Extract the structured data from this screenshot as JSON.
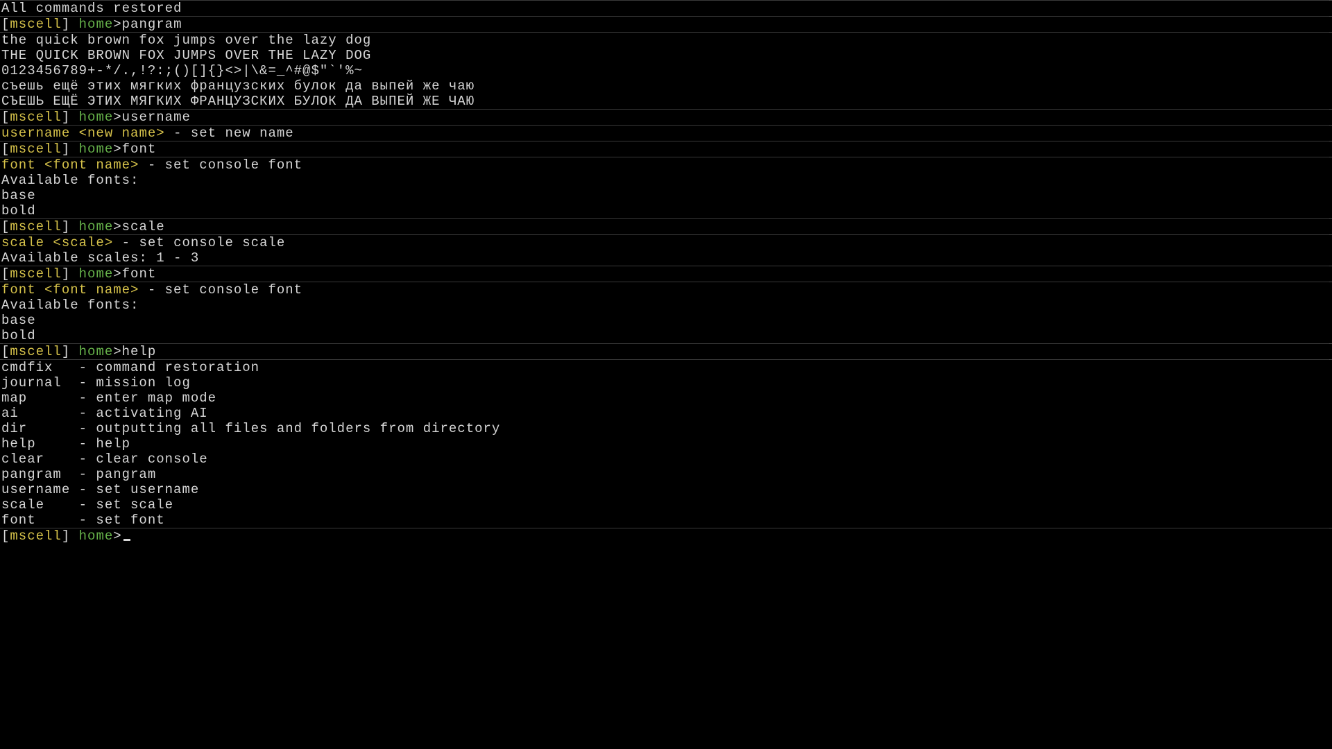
{
  "prompt": {
    "lb": "[",
    "user": "mscell",
    "rb": "]",
    "path": "home",
    "sep": ">"
  },
  "intro": {
    "restored": "All commands restored"
  },
  "history": [
    {
      "cmd": "pangram"
    },
    {
      "cmd": "username"
    },
    {
      "cmd": "font"
    },
    {
      "cmd": "scale"
    },
    {
      "cmd": "font"
    },
    {
      "cmd": "help"
    }
  ],
  "pangram_output": [
    "the quick brown fox jumps over the lazy dog",
    "THE QUICK BROWN FOX JUMPS OVER THE LAZY DOG",
    "0123456789+-*/.,!?:;()[]{}<>|\\&=_^#@$\"`'%~",
    "съешь ещё этих мягких французских булок да выпей же чаю",
    "СЪЕШЬ ЕЩЁ ЭТИХ МЯГКИХ ФРАНЦУЗСКИХ БУЛОК ДА ВЫПЕЙ ЖЕ ЧАЮ"
  ],
  "username_usage": {
    "cmd": "username ",
    "arg": "<new name>",
    "desc": " - set new name"
  },
  "font_usage": {
    "cmd": "font ",
    "arg": "<font name>",
    "desc": " - set console font",
    "avail_label": "Available fonts:",
    "fonts": [
      "base",
      "bold"
    ]
  },
  "scale_usage": {
    "cmd": "scale ",
    "arg": "<scale>",
    "desc": " - set console scale",
    "avail": "Available scales: 1 - 3"
  },
  "help": [
    {
      "name": "cmdfix",
      "desc": "command restoration"
    },
    {
      "name": "journal",
      "desc": "mission log"
    },
    {
      "name": "map",
      "desc": "enter map mode"
    },
    {
      "name": "ai",
      "desc": "activating AI"
    },
    {
      "name": "dir",
      "desc": "outputting all files and folders from directory"
    },
    {
      "name": "help",
      "desc": "help"
    },
    {
      "name": "clear",
      "desc": "clear console"
    },
    {
      "name": "pangram",
      "desc": "pangram"
    },
    {
      "name": "username",
      "desc": "set username"
    },
    {
      "name": "scale",
      "desc": "set scale"
    },
    {
      "name": "font",
      "desc": "set font"
    }
  ],
  "help_col_width": 8
}
